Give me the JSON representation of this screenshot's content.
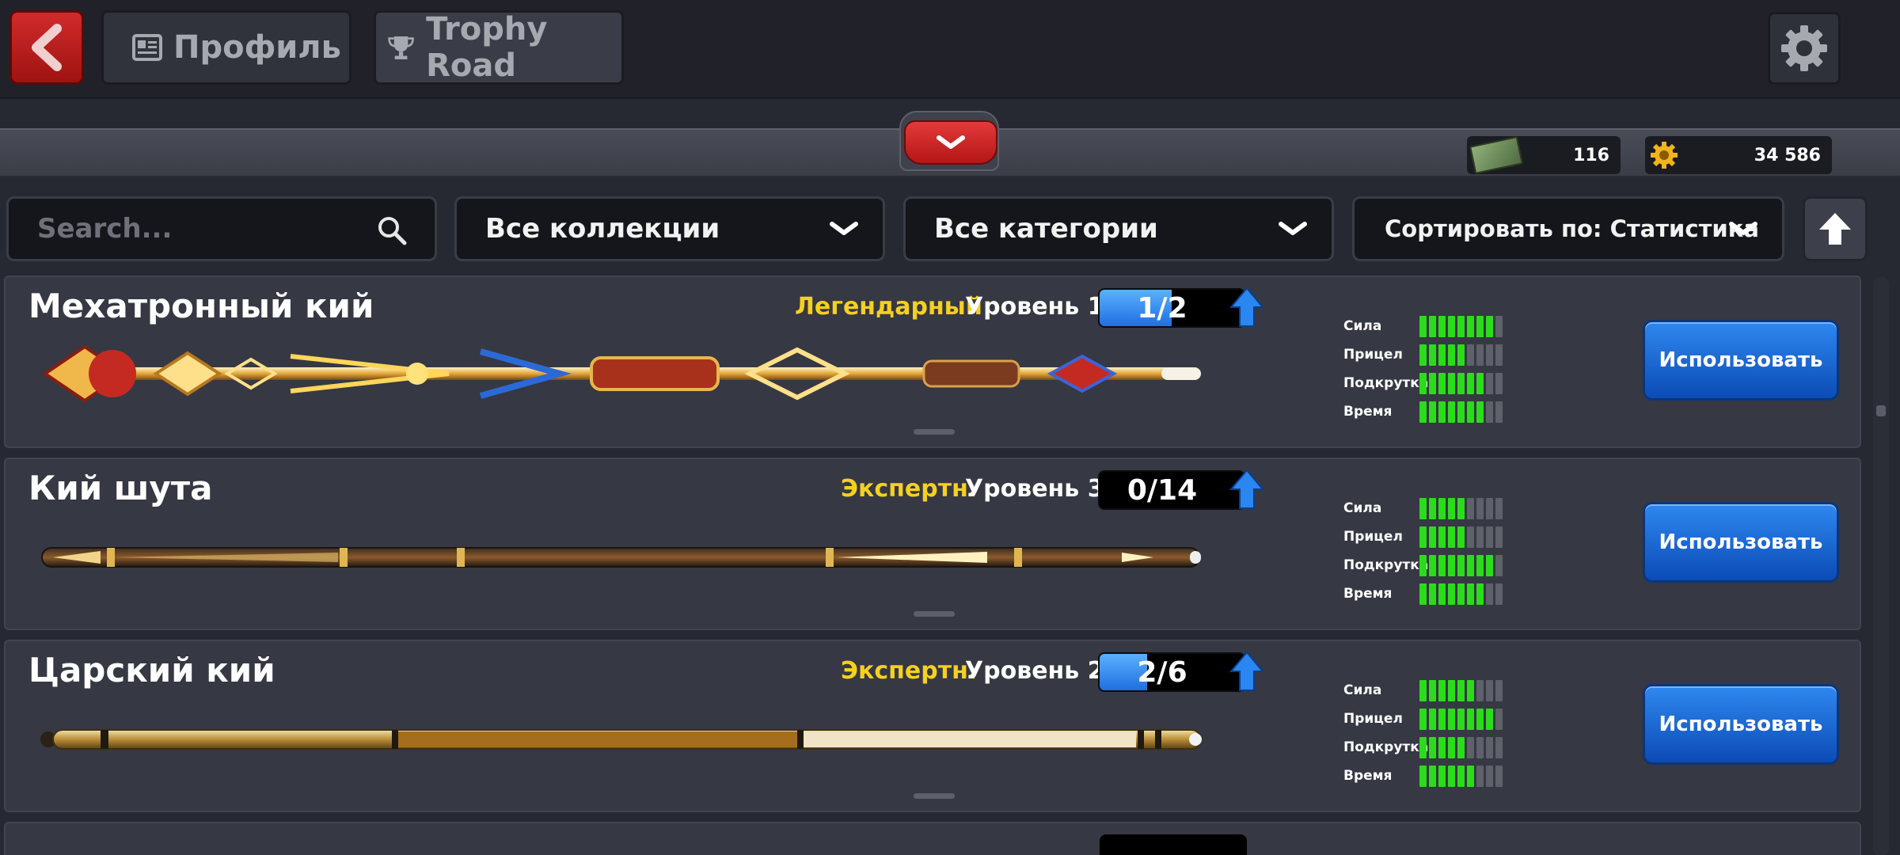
{
  "nav": {
    "back_label": "",
    "profile_label": "Профиль",
    "trophy_label": "Trophy Road"
  },
  "currency": {
    "cash": "116",
    "coins": "34 586"
  },
  "filters": {
    "search_placeholder": "Search...",
    "collections": "Все коллекции",
    "categories": "Все категории",
    "sort": "Сортировать по: Статистика"
  },
  "cues": [
    {
      "name": "Мехатронный кий",
      "rarity": "Легендарный",
      "rarity_color": "#f5d020",
      "level": "Уровень 1",
      "progress": "1/2",
      "progress_fraction": 0.5,
      "stats": [
        {
          "label": "Сила",
          "value": 8
        },
        {
          "label": "Прицел",
          "value": 5
        },
        {
          "label": "Подкрутка",
          "value": 7
        },
        {
          "label": "Время",
          "value": 7
        }
      ],
      "button": "Использовать"
    },
    {
      "name": "Кий шута",
      "rarity": "Экспертн.",
      "rarity_color": "#f5d020",
      "level": "Уровень 3",
      "progress": "0/14",
      "progress_fraction": 0,
      "stats": [
        {
          "label": "Сила",
          "value": 5
        },
        {
          "label": "Прицел",
          "value": 5
        },
        {
          "label": "Подкрутка",
          "value": 8
        },
        {
          "label": "Время",
          "value": 7
        }
      ],
      "button": "Использовать"
    },
    {
      "name": "Царский кий",
      "rarity": "Экспертн.",
      "rarity_color": "#f5d020",
      "level": "Уровень 2",
      "progress": "2/6",
      "progress_fraction": 0.33,
      "stats": [
        {
          "label": "Сила",
          "value": 6
        },
        {
          "label": "Прицел",
          "value": 8
        },
        {
          "label": "Подкрутка",
          "value": 5
        },
        {
          "label": "Время",
          "value": 6
        }
      ],
      "button": "Использовать"
    }
  ],
  "stat_max": 9,
  "colors": {
    "accent_blue": "#1f6fe0",
    "stat_on": "#2bdc1b",
    "rarity_gold": "#f5d020"
  }
}
